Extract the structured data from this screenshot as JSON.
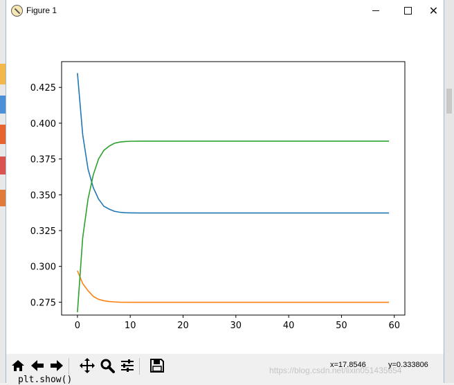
{
  "window": {
    "title": "Figure 1"
  },
  "toolbar": {
    "buttons": [
      {
        "name": "home-icon"
      },
      {
        "name": "back-icon"
      },
      {
        "name": "forward-icon"
      },
      {
        "name": "pan-icon"
      },
      {
        "name": "zoom-icon"
      },
      {
        "name": "configure-subplots-icon"
      },
      {
        "name": "save-icon"
      }
    ],
    "coord_x": "x=17.8546",
    "coord_y": "y=0.333806",
    "watermark": "https://blog.csdn.net/lixin051435654"
  },
  "behind": {
    "code_text": "plt.show()"
  },
  "colors": {
    "series_blue": "#1f77b4",
    "series_orange": "#ff7f0e",
    "series_green": "#2ca02c"
  },
  "chart_data": {
    "type": "line",
    "title": "",
    "xlabel": "",
    "ylabel": "",
    "xlim": [
      -3,
      62
    ],
    "ylim": [
      0.266,
      0.443
    ],
    "xticks": [
      0,
      10,
      20,
      30,
      40,
      50,
      60
    ],
    "yticks": [
      0.275,
      0.3,
      0.325,
      0.35,
      0.375,
      0.4,
      0.425
    ],
    "ytick_labels": [
      "0.275",
      "0.300",
      "0.325",
      "0.350",
      "0.375",
      "0.400",
      "0.425"
    ],
    "grid": false,
    "series": [
      {
        "color": "#1f77b4",
        "points": [
          [
            0,
            0.435
          ],
          [
            1,
            0.392
          ],
          [
            2,
            0.368
          ],
          [
            3,
            0.355
          ],
          [
            4,
            0.347
          ],
          [
            5,
            0.342
          ],
          [
            6,
            0.34
          ],
          [
            7,
            0.3385
          ],
          [
            8,
            0.3378
          ],
          [
            9,
            0.3375
          ],
          [
            10,
            0.3374
          ],
          [
            12,
            0.3373
          ],
          [
            15,
            0.3373
          ],
          [
            59,
            0.3373
          ]
        ]
      },
      {
        "color": "#ff7f0e",
        "points": [
          [
            0,
            0.297
          ],
          [
            1,
            0.288
          ],
          [
            2,
            0.283
          ],
          [
            3,
            0.279
          ],
          [
            4,
            0.277
          ],
          [
            5,
            0.276
          ],
          [
            6,
            0.2755
          ],
          [
            7,
            0.2752
          ],
          [
            8,
            0.275
          ],
          [
            10,
            0.2749
          ],
          [
            15,
            0.2749
          ],
          [
            59,
            0.2749
          ]
        ]
      },
      {
        "color": "#2ca02c",
        "points": [
          [
            0,
            0.268
          ],
          [
            1,
            0.32
          ],
          [
            2,
            0.347
          ],
          [
            3,
            0.364
          ],
          [
            4,
            0.375
          ],
          [
            5,
            0.381
          ],
          [
            6,
            0.384
          ],
          [
            7,
            0.386
          ],
          [
            8,
            0.3868
          ],
          [
            9,
            0.3872
          ],
          [
            10,
            0.3874
          ],
          [
            12,
            0.3875
          ],
          [
            15,
            0.3875
          ],
          [
            59,
            0.3875
          ]
        ]
      }
    ]
  }
}
